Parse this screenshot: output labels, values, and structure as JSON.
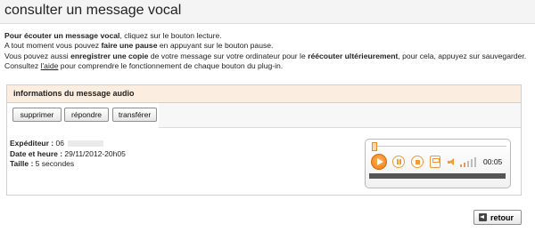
{
  "header": {
    "title": "consulter un message vocal"
  },
  "intro": {
    "l1_b": "Pour écouter un message vocal",
    "l1_t": ", cliquez sur le bouton lecture.",
    "l2_a": "A tout moment vous pouvez ",
    "l2_b": "faire une pause",
    "l2_c": " en appuyant sur le bouton pause.",
    "l3_a": "Vous pouvez aussi ",
    "l3_b": "enregistrer une copie",
    "l3_c": " de votre message sur votre ordinateur pour le ",
    "l3_d": "réécouter ultérieurement",
    "l3_e": ", pour cela, appuyez sur sauvegarder.",
    "l4_a": "Consultez ",
    "l4_link": "l'aide",
    "l4_c": " pour comprendre le fonctionnement de chaque bouton du plug-in."
  },
  "panel": {
    "title": "informations du message audio",
    "buttons": {
      "delete": "supprimer",
      "reply": "répondre",
      "forward": "transférer"
    }
  },
  "info": {
    "sender_label": "Expéditeur :",
    "sender_value": "06",
    "date_label": "Date et heure :",
    "date_value": "29/11/2012-20h05",
    "size_label": "Taille :",
    "size_value": "5 secondes"
  },
  "player": {
    "time": "00:05",
    "progress": 0.0
  },
  "footer": {
    "back": "retour"
  }
}
